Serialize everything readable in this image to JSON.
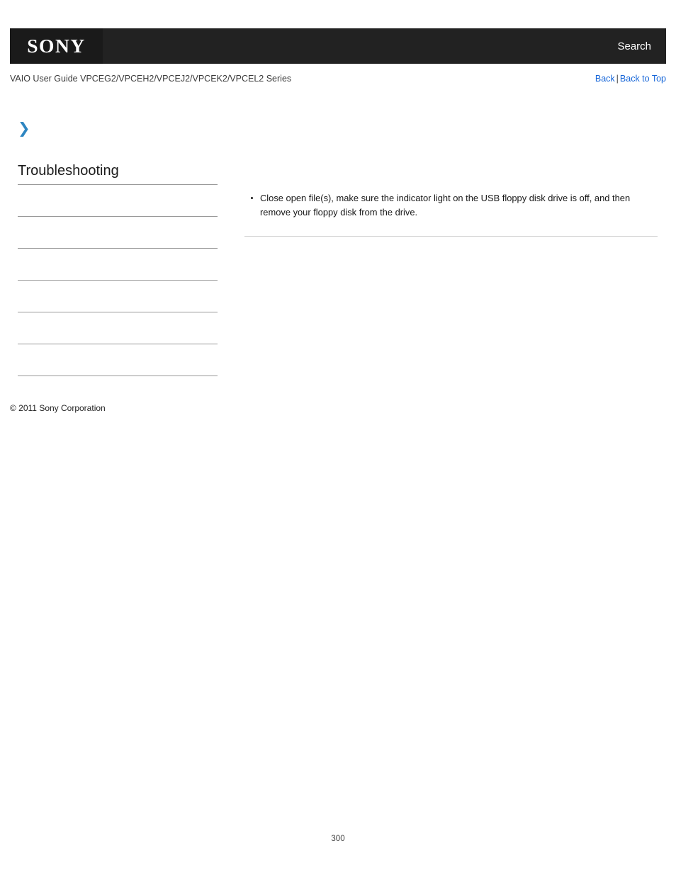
{
  "header": {
    "logo_text": "SONY",
    "search_label": "Search"
  },
  "breadcrumb": {
    "title": "VAIO User Guide VPCEG2/VPCEH2/VPCEJ2/VPCEK2/VPCEL2 Series",
    "back_label": "Back",
    "separator": "|",
    "back_to_top_label": "Back to Top"
  },
  "chevron": {
    "glyph": "❯"
  },
  "sidebar": {
    "heading": "Troubleshooting",
    "items": [
      {
        "label": ""
      },
      {
        "label": ""
      },
      {
        "label": ""
      },
      {
        "label": ""
      },
      {
        "label": ""
      },
      {
        "label": ""
      },
      {
        "label": ""
      }
    ]
  },
  "footer": {
    "copyright": "© 2011 Sony Corporation",
    "page_number": "300"
  },
  "main": {
    "bullets": [
      "Close open file(s), make sure the indicator light on the USB floppy disk drive is off, and then remove your floppy disk from the drive."
    ]
  },
  "colors": {
    "header_bg": "#222222",
    "logo_bg": "#1a1a1a",
    "link_blue": "#1565d8",
    "accent_blue": "#2e86c1",
    "rule_gray": "#d2d2d2",
    "divider_gray": "#999999"
  }
}
